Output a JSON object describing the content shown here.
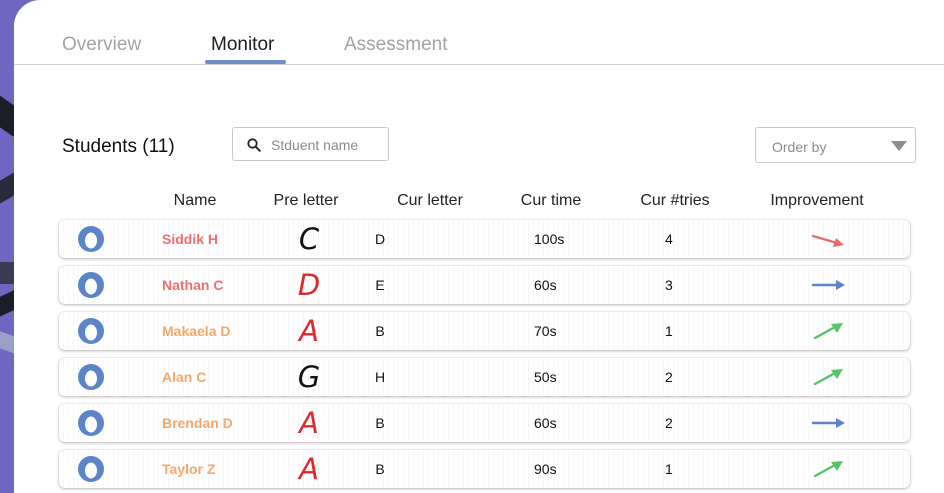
{
  "tabs": [
    {
      "label": "Overview",
      "active": false
    },
    {
      "label": "Monitor",
      "active": true
    },
    {
      "label": "Assessment",
      "active": false
    }
  ],
  "students": {
    "title": "Students (11)",
    "search_placeholder": "Stduent name",
    "order_label": "Order by"
  },
  "columns": {
    "name": "Name",
    "pre_letter": "Pre letter",
    "cur_letter": "Cur letter",
    "cur_time": "Cur time",
    "cur_tries": "Cur #tries",
    "improvement": "Improvement"
  },
  "colors": {
    "brand_background": "#6f66c2",
    "avatar": "#5b84c9",
    "name_red": "#ef6f6f",
    "name_orange": "#f5a86b",
    "trend_down": "#ee6b6b",
    "trend_flat": "#5b84c9",
    "trend_up": "#56c46a"
  },
  "rows": [
    {
      "name": "Siddik H",
      "name_color": "#ef6f6f",
      "pre_letter": "C",
      "pre_letter_color": "#111111",
      "cur_letter": "D",
      "cur_time": "100s",
      "cur_tries": "4",
      "improvement": "down"
    },
    {
      "name": "Nathan C",
      "name_color": "#ef6f6f",
      "pre_letter": "D",
      "pre_letter_color": "#e0282d",
      "cur_letter": "E",
      "cur_time": "60s",
      "cur_tries": "3",
      "improvement": "flat"
    },
    {
      "name": "Makaela D",
      "name_color": "#f5a86b",
      "pre_letter": "A",
      "pre_letter_color": "#e0282d",
      "cur_letter": "B",
      "cur_time": "70s",
      "cur_tries": "1",
      "improvement": "up"
    },
    {
      "name": "Alan C",
      "name_color": "#f5a86b",
      "pre_letter": "G",
      "pre_letter_color": "#111111",
      "cur_letter": "H",
      "cur_time": "50s",
      "cur_tries": "2",
      "improvement": "up"
    },
    {
      "name": "Brendan D",
      "name_color": "#f5a86b",
      "pre_letter": "A",
      "pre_letter_color": "#e0282d",
      "cur_letter": "B",
      "cur_time": "60s",
      "cur_tries": "2",
      "improvement": "flat"
    },
    {
      "name": "Taylor Z",
      "name_color": "#f5a86b",
      "pre_letter": "A",
      "pre_letter_color": "#e0282d",
      "cur_letter": "B",
      "cur_time": "90s",
      "cur_tries": "1",
      "improvement": "up"
    }
  ]
}
